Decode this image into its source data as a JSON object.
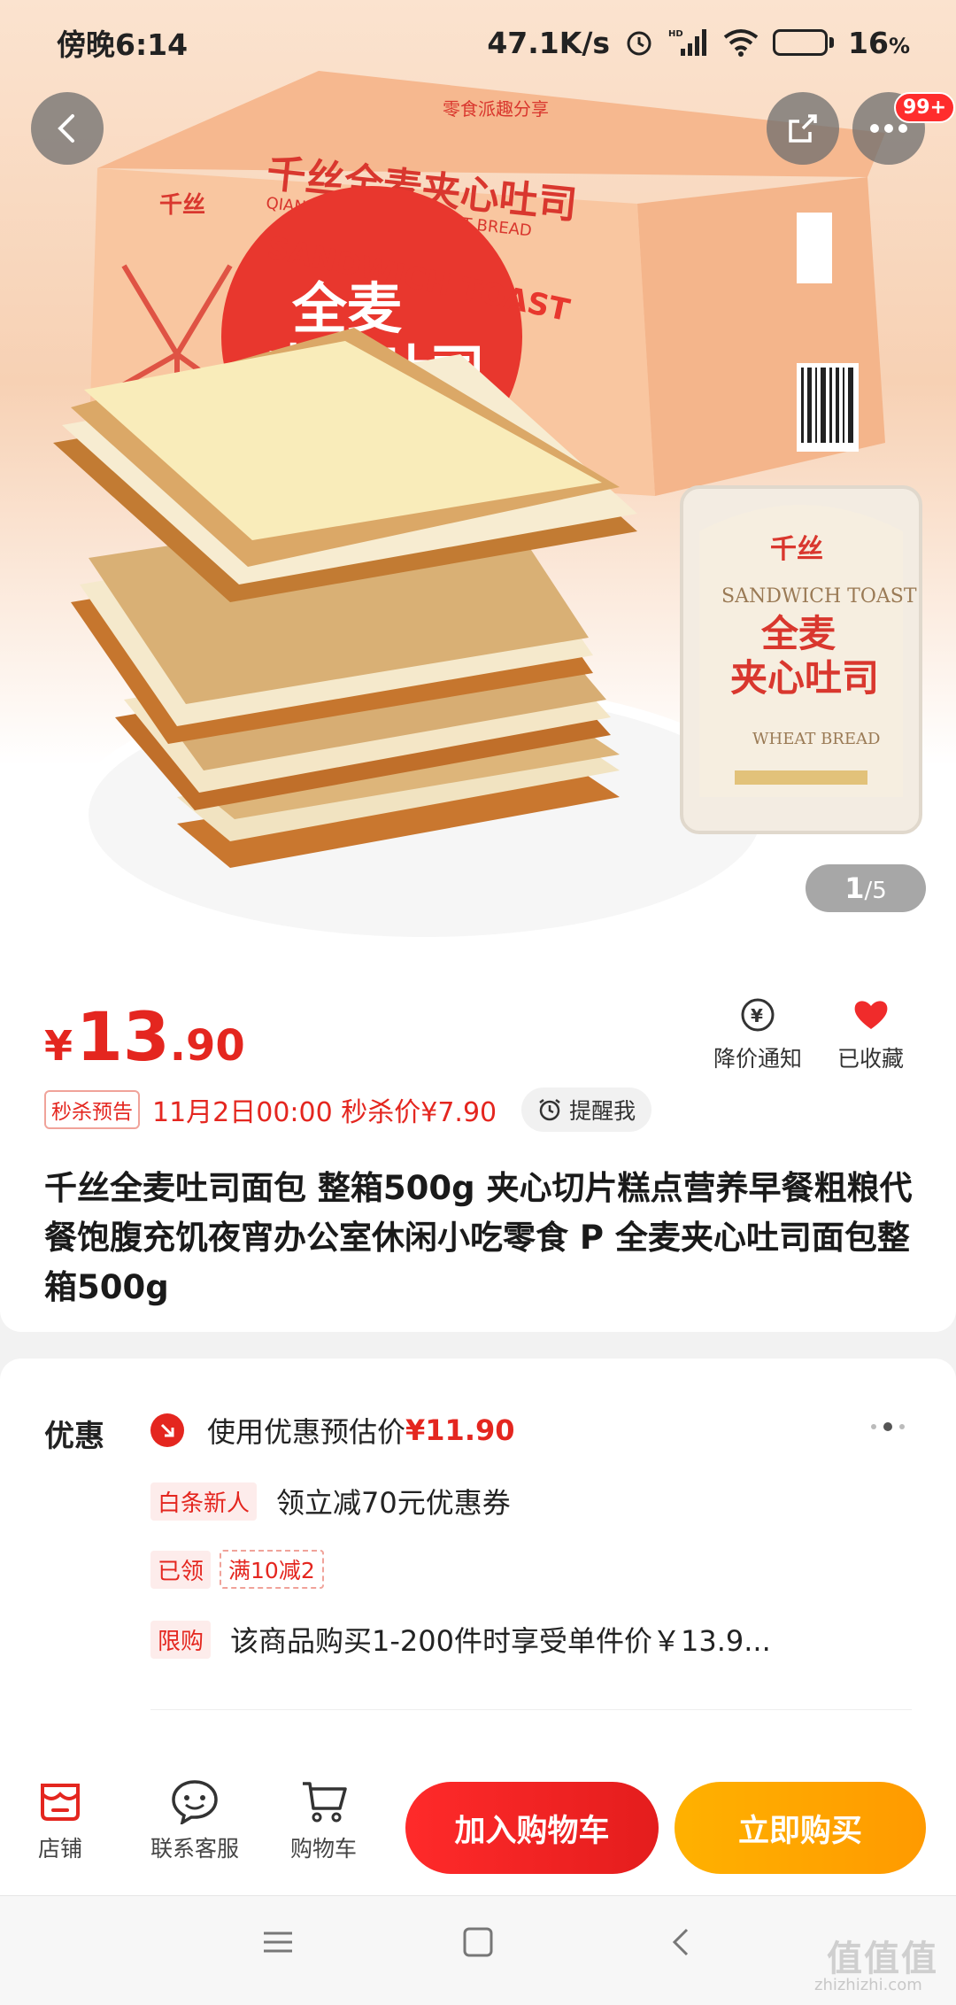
{
  "status_bar": {
    "time": "傍晚6:14",
    "net_speed": "47.1K/s",
    "hd_label": "HD",
    "battery_level": 0.16,
    "battery_text": "16",
    "battery_unit": "%"
  },
  "hero": {
    "pager_current": "1",
    "pager_total": "/5",
    "badge": "99+",
    "box_texts": {
      "brand_top": "零食派趣分享",
      "box_title_cn": "千丝全麦夹心吐司",
      "box_title_en": "QIANSI SANDWICH TOAST BREAD",
      "sandwich_toast": "SANDWICH TOAST",
      "big_line1": "全麦",
      "big_line2": "夹心吐司",
      "pack_title1": "全麦",
      "pack_title2": "夹心吐司",
      "pack_en": "SANDWICH TOAST",
      "pack_wheat": "WHEAT BREAD",
      "brand_logo": "千丝"
    }
  },
  "price": {
    "currency": "¥",
    "integer": "13",
    "decimal": ".90"
  },
  "actions": {
    "notify_label": "降价通知",
    "fav_label": "已收藏"
  },
  "flash_sale": {
    "tag": "秒杀预告",
    "text": "11月2日00:00 秒杀价¥7.90",
    "remind": "提醒我"
  },
  "product_title": "千丝全麦吐司面包 整箱500g 夹心切片糕点营养早餐粗粮代餐饱腹充饥夜宵办公室休闲小吃零食 P 全麦夹心吐司面包整箱500g",
  "promotions": {
    "label": "优惠",
    "estimate_text": "使用优惠预估价",
    "estimate_price": "¥11.90",
    "rows": [
      {
        "tag": "白条新人",
        "text": "领立减70元优惠券"
      },
      {
        "tag": "已领",
        "coupon": "满10减2"
      },
      {
        "tag": "限购",
        "text": "该商品购买1-200件时享受单件价￥13.9..."
      }
    ]
  },
  "bottom_bar": {
    "shop_label": "店铺",
    "service_label": "联系客服",
    "cart_label": "购物车",
    "add_cart_button": "加入购物车",
    "buy_now_button": "立即购买"
  },
  "watermark": {
    "logo": "值值值",
    "url": "zhizhizhi.com"
  },
  "colors": {
    "accent_red": "#e4261f",
    "buy_orange": "#ffa500"
  }
}
